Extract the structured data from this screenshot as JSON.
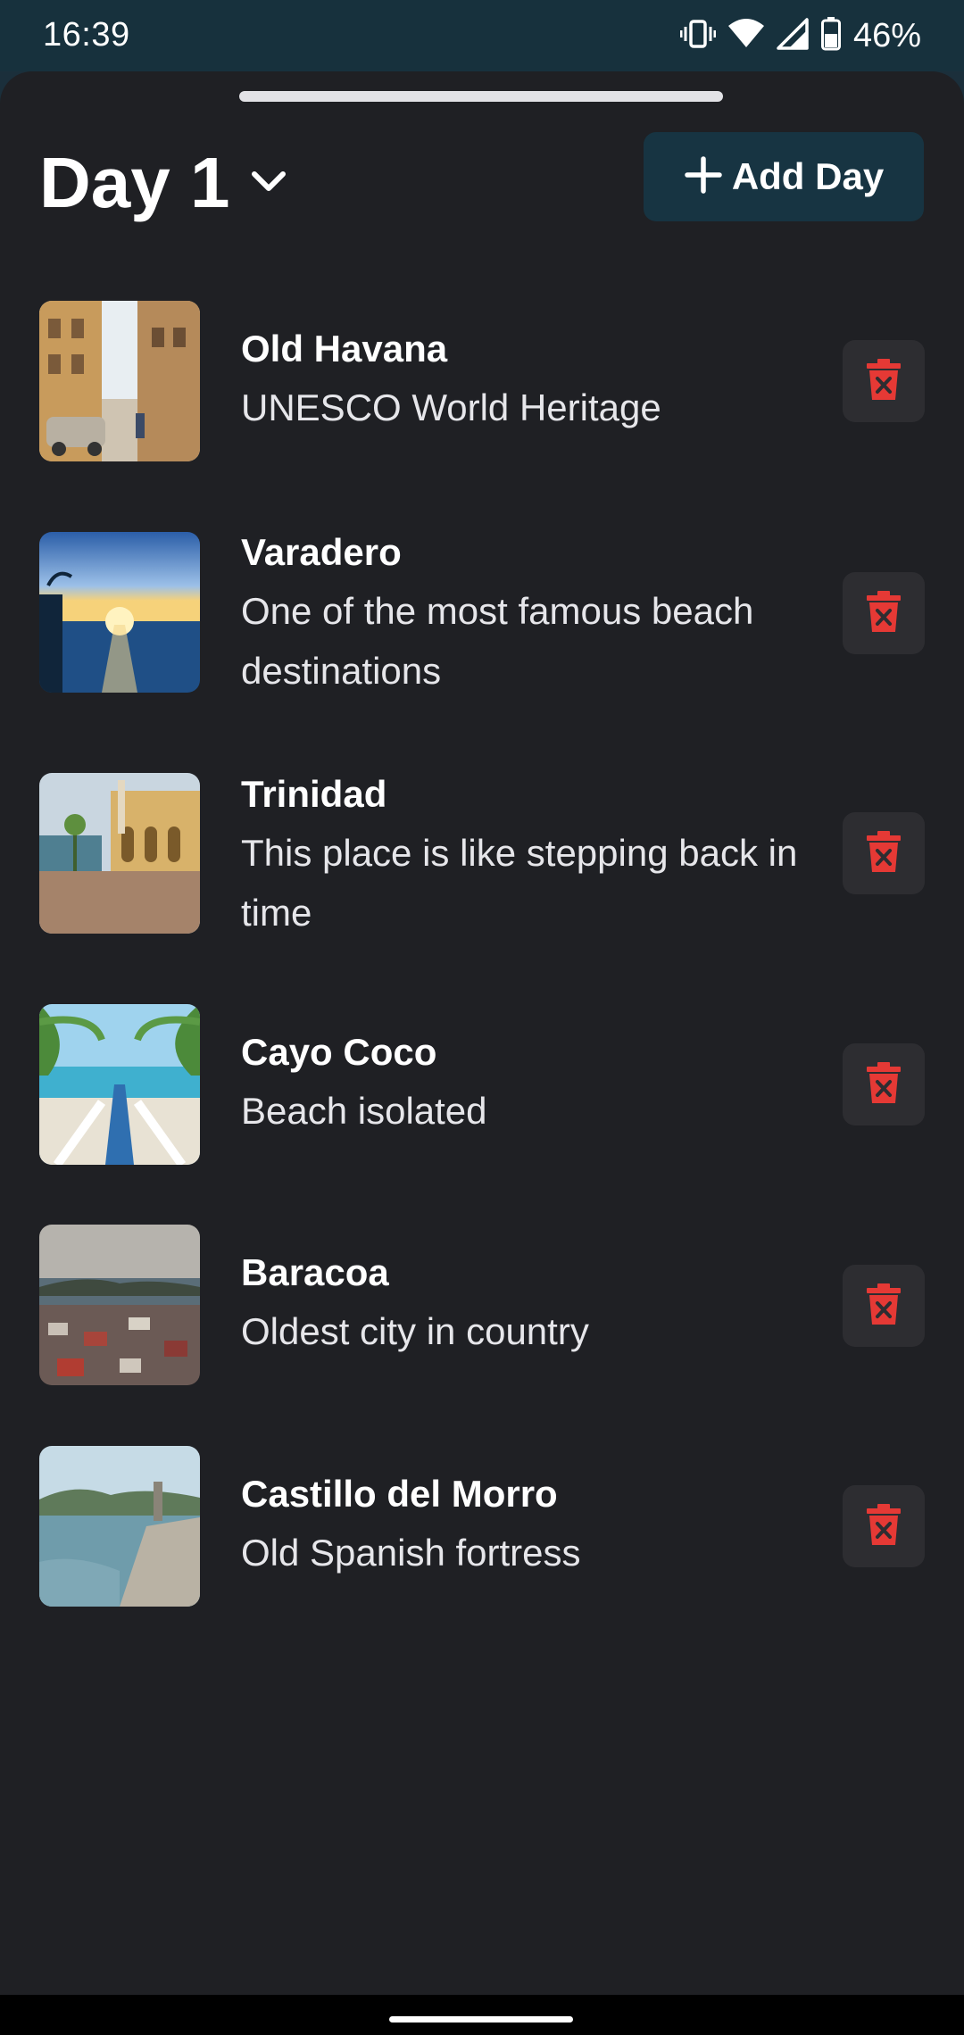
{
  "status_bar": {
    "time": "16:39",
    "battery": "46%",
    "icons": [
      "vibrate-icon",
      "wifi-icon",
      "signal-icon",
      "battery-icon"
    ]
  },
  "header": {
    "day_title": "Day 1",
    "add_day_label": "Add Day"
  },
  "places": [
    {
      "name": "Old Havana",
      "description": "UNESCO World Heritage"
    },
    {
      "name": "Varadero",
      "description": "One of the most famous beach destinations"
    },
    {
      "name": "Trinidad",
      "description": "This place is like stepping back in time"
    },
    {
      "name": "Cayo Coco",
      "description": "Beach isolated"
    },
    {
      "name": "Baracoa",
      "description": "Oldest city in country"
    },
    {
      "name": "Castillo del Morro",
      "description": "Old Spanish fortress"
    }
  ],
  "colors": {
    "accent_button": "#173442",
    "delete_icon": "#e53935",
    "sheet_background": "#1f2024",
    "status_bar": "#17313d"
  }
}
